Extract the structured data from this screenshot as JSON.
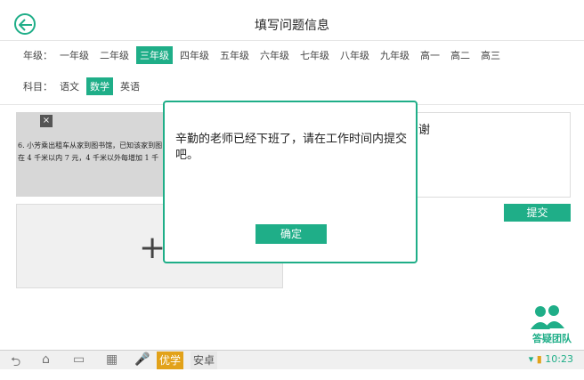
{
  "header": {
    "title": "填写问题信息"
  },
  "grades": {
    "label": "年级：",
    "items": [
      "一年级",
      "二年级",
      "三年级",
      "四年级",
      "五年级",
      "六年级",
      "七年级",
      "八年级",
      "九年级",
      "高一",
      "高二",
      "高三"
    ],
    "active": "三年级"
  },
  "subjects": {
    "label": "科目：",
    "items": [
      "语文",
      "数学",
      "英语"
    ],
    "active": "数学"
  },
  "photo": {
    "close_glyph": "×",
    "lines": [
      "6. 小芳乘出租车从家到图书馆，已知该家到图",
      "在 4 千米以内 7 元，4 千米以外每增加 1 千"
    ]
  },
  "add_photo": {
    "glyph": "+"
  },
  "description": {
    "text": "谢"
  },
  "submit": {
    "label": "提交"
  },
  "dialog": {
    "message": "辛勤的老师已经下班了，请在工作时间内提交吧。",
    "ok_label": "确定"
  },
  "watermark": {
    "text": "答疑团队"
  },
  "navbar": {
    "chip1": "优学",
    "chip2": "安卓",
    "time": "10:23"
  },
  "colors": {
    "accent": "#1fae88"
  }
}
